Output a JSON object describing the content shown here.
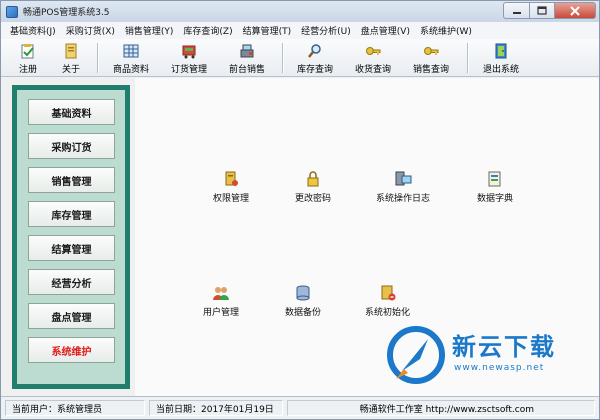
{
  "window": {
    "title": "畅通POS管理系统3.5"
  },
  "menubar": [
    "基础资料(J)",
    "采购订货(X)",
    "销售管理(Y)",
    "库存查询(Z)",
    "结算管理(T)",
    "经营分析(U)",
    "盘点管理(V)",
    "系统维护(W)"
  ],
  "toolbar": {
    "register": "注册",
    "about": "关于",
    "product_info": "商品资料",
    "order_mgmt": "订货管理",
    "front_sales": "前台销售",
    "stock_query": "库存查询",
    "receipt_query": "收货查询",
    "sales_query": "销售查询",
    "exit": "退出系统"
  },
  "nav": [
    {
      "label": "基础资料"
    },
    {
      "label": "采购订货"
    },
    {
      "label": "销售管理"
    },
    {
      "label": "库存管理"
    },
    {
      "label": "结算管理"
    },
    {
      "label": "经营分析"
    },
    {
      "label": "盘点管理"
    },
    {
      "label": "系统维护",
      "active": true
    }
  ],
  "functions": {
    "permission": "权限管理",
    "change_password": "更改密码",
    "operation_log": "系统操作日志",
    "data_dictionary": "数据字典",
    "user_mgmt": "用户管理",
    "data_backup": "数据备份",
    "system_init": "系统初始化"
  },
  "watermark": {
    "title": "新云下载",
    "url": "www.newasp.net"
  },
  "statusbar": {
    "current_user": "当前用户：系统管理员",
    "current_date": "当前日期：2017年01月19日",
    "company": "畅通软件工作室 http://www.zsctsoft.com"
  },
  "colors": {
    "nav_frame": "#1f7f6c",
    "nav_inner": "#bcdcd1",
    "active_nav_text": "#e11a1a",
    "watermark": "#1c79c9"
  }
}
